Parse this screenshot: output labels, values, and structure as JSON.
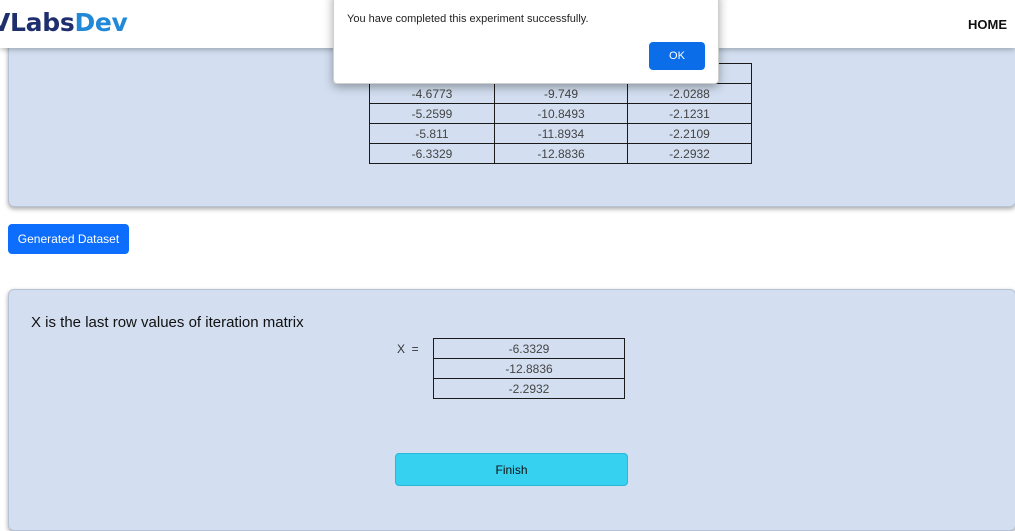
{
  "navbar": {
    "brand_part1": "VLabs",
    "brand_part2": "Dev",
    "home_label": "HOME"
  },
  "iteration_table": {
    "rows": [
      [
        "",
        "",
        ""
      ],
      [
        "-4.6773",
        "-9.749",
        "-2.0288"
      ],
      [
        "-5.2599",
        "-10.8493",
        "-2.1231"
      ],
      [
        "-5.811",
        "-11.8934",
        "-2.2109"
      ],
      [
        "-6.3329",
        "-12.8836",
        "-2.2932"
      ]
    ]
  },
  "dataset_button_label": "Generated Dataset",
  "result": {
    "title": "X is the last row values of iteration matrix",
    "x_label": "X  =",
    "values": [
      "-6.3329",
      "-12.8836",
      "-2.2932"
    ]
  },
  "finish_button_label": "Finish",
  "dialog": {
    "message": "You have completed this experiment successfully.",
    "ok_label": "OK"
  },
  "colors": {
    "card_bg": "#d3dff1",
    "primary": "#0d6efd",
    "finish": "#36d0f0",
    "brand_dark": "#1f2f6e",
    "brand_light": "#2189d8"
  }
}
